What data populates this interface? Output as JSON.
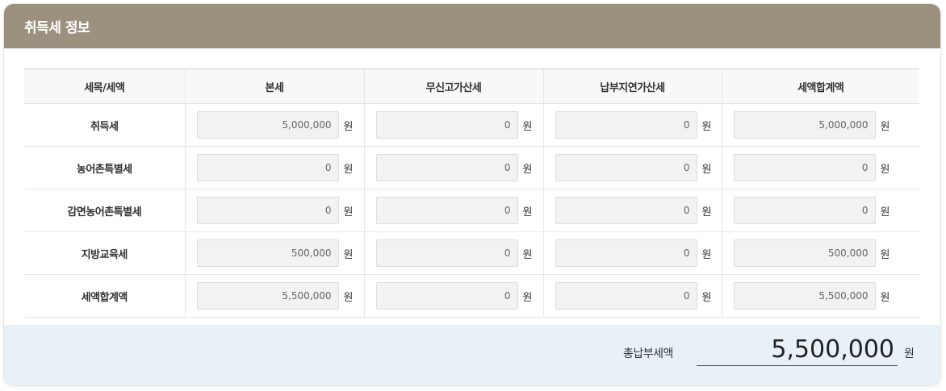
{
  "panel": {
    "title": "취득세 정보"
  },
  "table": {
    "headers": [
      "세목/세액",
      "본세",
      "무신고가산세",
      "납부지연가산세",
      "세액합계액"
    ],
    "unit": "원",
    "rows": [
      {
        "label": "취득세",
        "values": [
          "5,000,000",
          "0",
          "0",
          "5,000,000"
        ]
      },
      {
        "label": "농어촌특별세",
        "values": [
          "0",
          "0",
          "0",
          "0"
        ]
      },
      {
        "label": "감면농어촌특별세",
        "values": [
          "0",
          "0",
          "0",
          "0"
        ]
      },
      {
        "label": "지방교육세",
        "values": [
          "500,000",
          "0",
          "0",
          "500,000"
        ]
      },
      {
        "label": "세액합계액",
        "values": [
          "5,500,000",
          "0",
          "0",
          "5,500,000"
        ]
      }
    ]
  },
  "total": {
    "label": "총납부세액",
    "value": "5,500,000",
    "unit": "원"
  },
  "colors": {
    "header_bg": "#9c917f",
    "footer_bg": "#e9f1f8",
    "input_bg": "#f2f2f2"
  }
}
